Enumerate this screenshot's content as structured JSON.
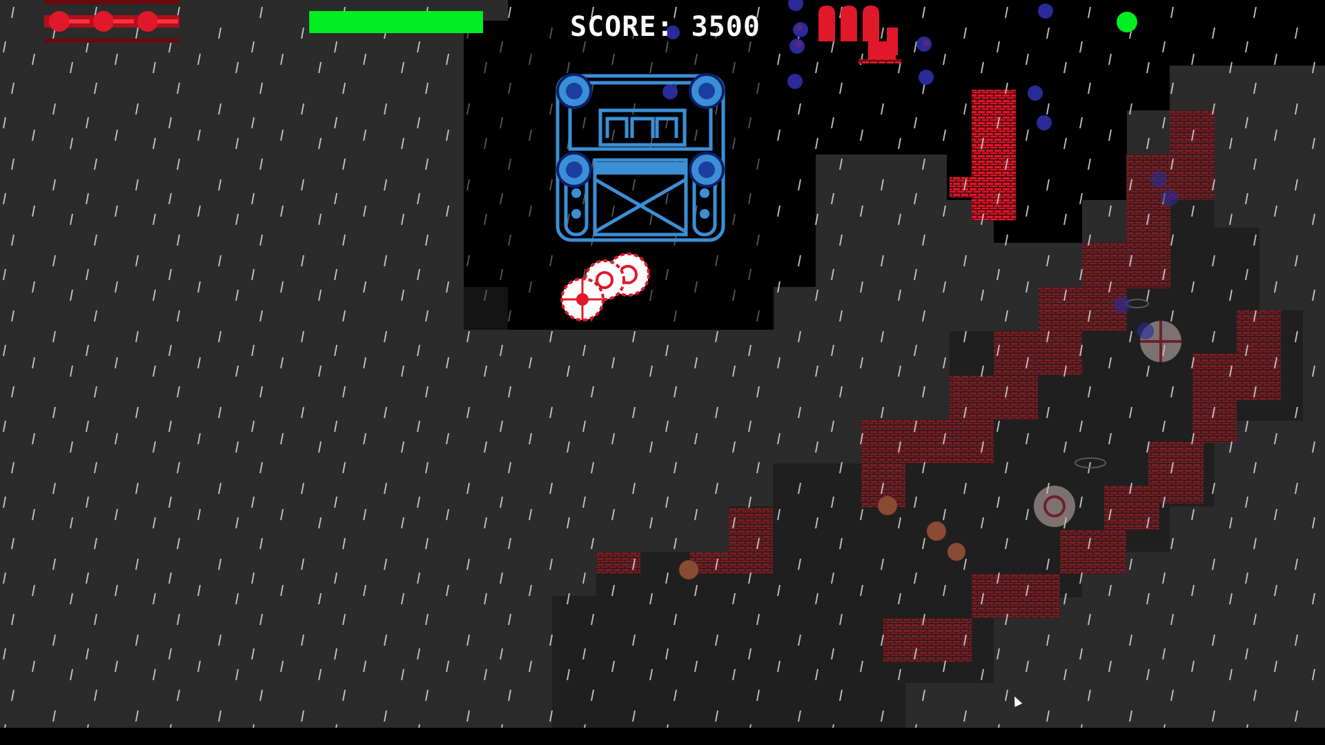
{
  "hud": {
    "score_text": "SCORE: 3500",
    "health_fraction": 1.0,
    "lives_count": 3,
    "ammo_count": 3,
    "status_dot_color": "#00ee22",
    "health_color": "#00ee22"
  },
  "colors": {
    "ground": "#2b2b2b",
    "void": "#000000",
    "brick": "#7a1e24",
    "brick_bright": "#d81a28",
    "boss": "#3b8fd6",
    "enemy_orb": "#2a2a9a",
    "rain": "#d8d8d8"
  },
  "icons": {
    "life": "red-tank-life-icon",
    "ammo": "red-shell-ammo-icon",
    "boss": "blue-fortress-boss-sprite",
    "player": "red-white-target-player-sprite"
  }
}
